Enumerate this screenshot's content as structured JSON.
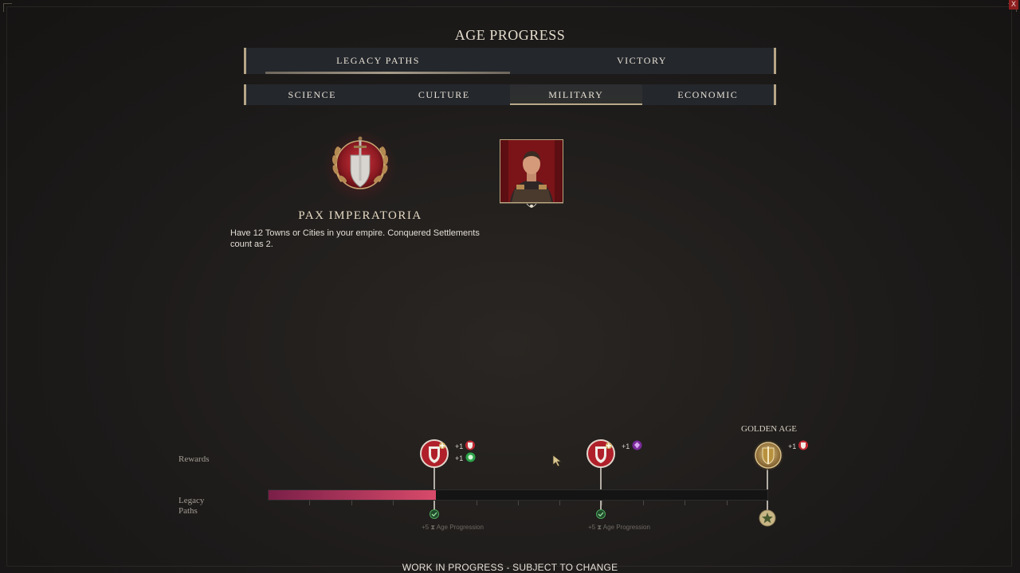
{
  "window": {
    "close_label": "X"
  },
  "title": "AGE PROGRESS",
  "main_tabs": [
    {
      "label": "LEGACY PATHS",
      "active": true
    },
    {
      "label": "VICTORY",
      "active": false
    }
  ],
  "sub_tabs": [
    {
      "label": "SCIENCE",
      "active": false
    },
    {
      "label": "CULTURE",
      "active": false
    },
    {
      "label": "MILITARY",
      "active": true
    },
    {
      "label": "ECONOMIC",
      "active": false
    }
  ],
  "legacy_path": {
    "name": "PAX IMPERATORIA",
    "description": "Have 12 Towns or Cities in your empire. Conquered Settlements count as 2.",
    "emblem_icon": "sword-shield-laurel-icon",
    "leader_portrait": "leader-portrait"
  },
  "timeline": {
    "rewards_label": "Rewards",
    "paths_label": "Legacy\nPaths",
    "progress_fraction": 0.335,
    "golden_age_label": "GOLDEN AGE",
    "milestones": [
      {
        "icon": "military-reward-icon",
        "rewards": [
          {
            "text": "+1",
            "icon": "shield-red-icon"
          },
          {
            "text": "+1",
            "icon": "green-token-icon"
          }
        ],
        "age_progress": "+5",
        "age_progress_label": "Age Progression"
      },
      {
        "icon": "military-reward-icon",
        "rewards": [
          {
            "text": "+1",
            "icon": "purple-gem-icon"
          }
        ],
        "age_progress": "+5",
        "age_progress_label": "Age Progression"
      },
      {
        "icon": "golden-age-shield-icon",
        "rewards": [
          {
            "text": "+1",
            "icon": "shield-red-icon"
          }
        ]
      }
    ]
  },
  "footer": "WORK IN PROGRESS - SUBJECT TO CHANGE",
  "colors": {
    "accent_gold": "#b7a687",
    "progress_start": "#7a1f48",
    "progress_end": "#d84a6a",
    "reward_red": "#b0202a"
  }
}
